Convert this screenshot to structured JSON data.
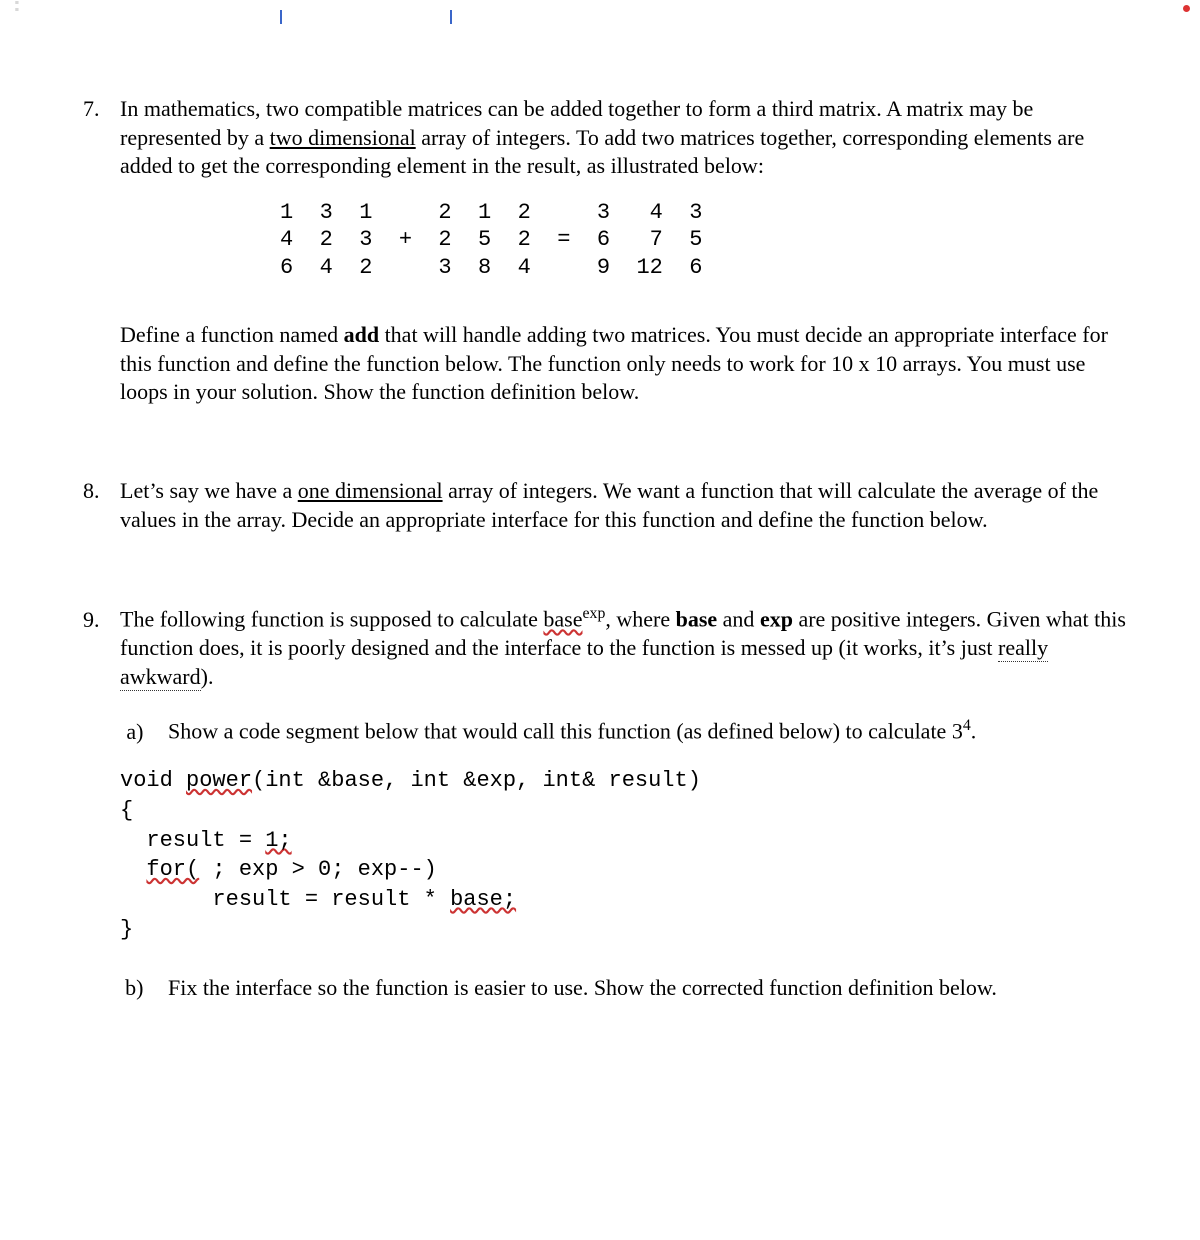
{
  "q7": {
    "number": "7.",
    "intro_pre": "In mathematics, two compatible matrices can be added together to form a third matrix. A matrix may be represented by a ",
    "intro_link": "two dimensional",
    "intro_post": " array of integers. To add two matrices together, corresponding elements are added to get the corresponding element in the result, as illustrated below:",
    "matrix_row1": "1  3  1     2  1  2     3   4  3",
    "matrix_row2": "4  2  3  +  2  5  2  =  6   7  5",
    "matrix_row3": "6  4  2     3  8  4     9  12  6",
    "define_pre": "Define a function named ",
    "define_bold": "add",
    "define_post": " that will handle adding two matrices. You must decide an appropriate interface for this function and define the function below. The function only needs to work for 10 x 10 arrays. You must use loops in your solution. Show the function definition below."
  },
  "q8": {
    "number": "8.",
    "pre": "Let’s say we have a ",
    "link": "one dimensional",
    "post": " array of integers. We want a function that will calculate the average of the values in the array. Decide an appropriate interface for this function and define the function below."
  },
  "q9": {
    "number": "9.",
    "intro_pre": "The following function is supposed to calculate ",
    "base_word": "base",
    "exp_sup": "exp",
    "intro_mid": ", where ",
    "bold_base": "base",
    "and": " and ",
    "bold_exp": "exp",
    "intro_post": " are positive integers. Given what this function does, it is poorly designed and the interface to the function is messed up (it works, it’s just ",
    "awk": "really awkward",
    "intro_end": ").",
    "a_text": "Show a code segment below that would call this function (as defined below) to calculate 3",
    "a_sup": "4",
    "a_end": ".",
    "code_l1a": "void ",
    "code_l1_power": "power",
    "code_l1b": "(int &base, int &exp, int& result)",
    "code_l2": "{",
    "code_l3a": "  result = ",
    "code_l3b": "1;",
    "code_l4a": "  ",
    "code_l4_for": "for(",
    "code_l4b": " ; exp > 0; exp--)",
    "code_l5a": "       result = result * ",
    "code_l5b": "base;",
    "code_l6": "}",
    "b_text": "Fix the interface so the function is easier to use. Show the corrected function definition below."
  }
}
